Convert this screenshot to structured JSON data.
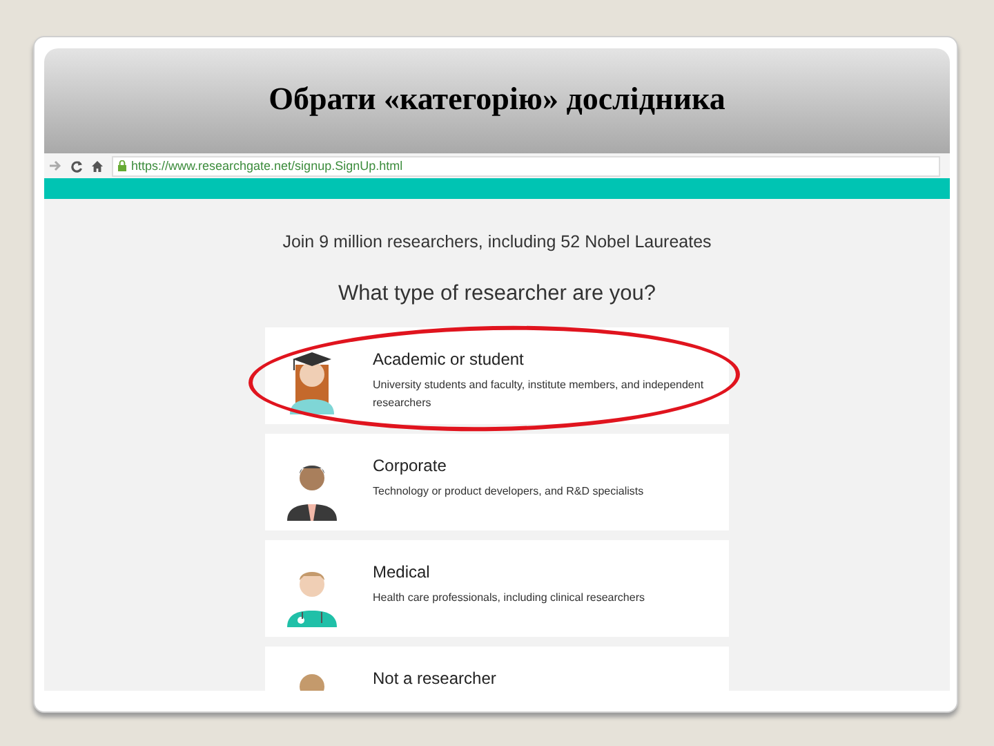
{
  "slide": {
    "title": "Обрати «категорію» дослідника"
  },
  "browser": {
    "url": "https://www.researchgate.net/signup.SignUp.html"
  },
  "page": {
    "tagline": "Join 9 million researchers, including 52 Nobel Laureates",
    "question": "What type of researcher are you?",
    "options": [
      {
        "kind": "student",
        "title": "Academic or student",
        "description": "University students and faculty, institute members, and independent researchers",
        "circled": true
      },
      {
        "kind": "corporate",
        "title": "Corporate",
        "description": "Technology or product developers, and R&D specialists",
        "circled": false
      },
      {
        "kind": "medical",
        "title": "Medical",
        "description": "Health care professionals, including clinical researchers",
        "circled": false
      },
      {
        "kind": "other",
        "title": "Not a researcher",
        "circled": false
      }
    ]
  }
}
